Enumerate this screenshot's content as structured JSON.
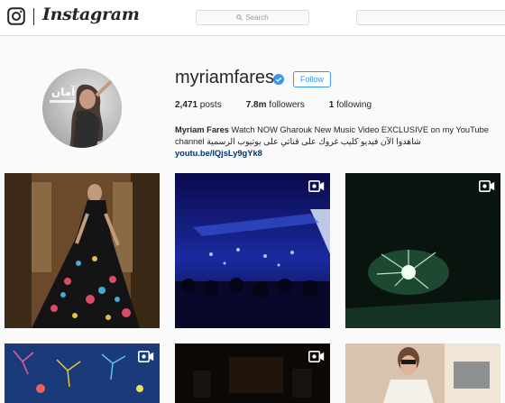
{
  "nav": {
    "wordmark": "Instagram",
    "search_placeholder": "Search"
  },
  "profile": {
    "username": "myriamfares",
    "follow_label": "Follow",
    "avatar_overlay_text": "آمان",
    "stats": {
      "posts_count": "2,471",
      "posts_label": " posts",
      "followers_count": "7.8m",
      "followers_label": " followers",
      "following_count": "1",
      "following_label": " following"
    },
    "bio": {
      "name": "Myriam Fares",
      "text": " Watch NOW Gharouk New Music Video EXCLUSIVE on my YouTube channel شاهدوا الآن فيديو كليب غروك على قناتي على يوتيوب الرسمية ",
      "link": "youtu.be/lQjsLy9gYk8"
    }
  },
  "posts": [
    {
      "type": "photo",
      "subject": "woman in floral dress"
    },
    {
      "type": "video",
      "subject": "concert crowd"
    },
    {
      "type": "video",
      "subject": "fireworks"
    },
    {
      "type": "video",
      "subject": "fireworks pattern"
    },
    {
      "type": "video",
      "subject": "dark stage"
    },
    {
      "type": "photo",
      "subject": "woman in airplane cabin"
    }
  ],
  "colors": {
    "accent": "#3897f0",
    "link": "#003569",
    "verified": "#3897f0"
  }
}
